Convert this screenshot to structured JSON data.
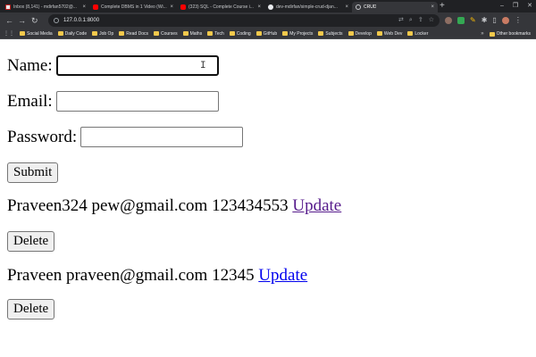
{
  "browser": {
    "tabs": [
      {
        "icon": "gmail-icon",
        "title": "Inbox (8,141) - mdirfan5702@..."
      },
      {
        "icon": "youtube-icon",
        "title": "Complete DBMS in 1 Video (Wi..."
      },
      {
        "icon": "youtube-icon",
        "title": "(323) SQL - Complete Course i..."
      },
      {
        "icon": "github-icon",
        "title": "dev-mdirfan/simple-crud-djan..."
      },
      {
        "icon": "globe-icon",
        "title": "CRUD"
      }
    ],
    "new_tab": "+",
    "url": "127.0.0.1:8000",
    "bookmarks": [
      "Social Media",
      "Daily Code",
      "Job Op",
      "Read Docs",
      "Courses",
      "Maths",
      "Tech",
      "Coding",
      "GitHub",
      "My Projects",
      "Subjects",
      "Develop",
      "Web Dev",
      "Locker"
    ],
    "other_bookmarks": "Other bookmarks"
  },
  "form": {
    "name_label": "Name:",
    "name_value": "",
    "email_label": "Email:",
    "email_value": "",
    "password_label": "Password:",
    "password_value": "",
    "submit_label": "Submit"
  },
  "records": [
    {
      "name": "Praveen324",
      "email": "pew@gmail.com",
      "phone": "123434553",
      "update_label": "Update",
      "delete_label": "Delete"
    },
    {
      "name": "Praveen",
      "email": "praveen@gmail.com",
      "phone": "12345",
      "update_label": "Update",
      "delete_label": "Delete"
    }
  ]
}
